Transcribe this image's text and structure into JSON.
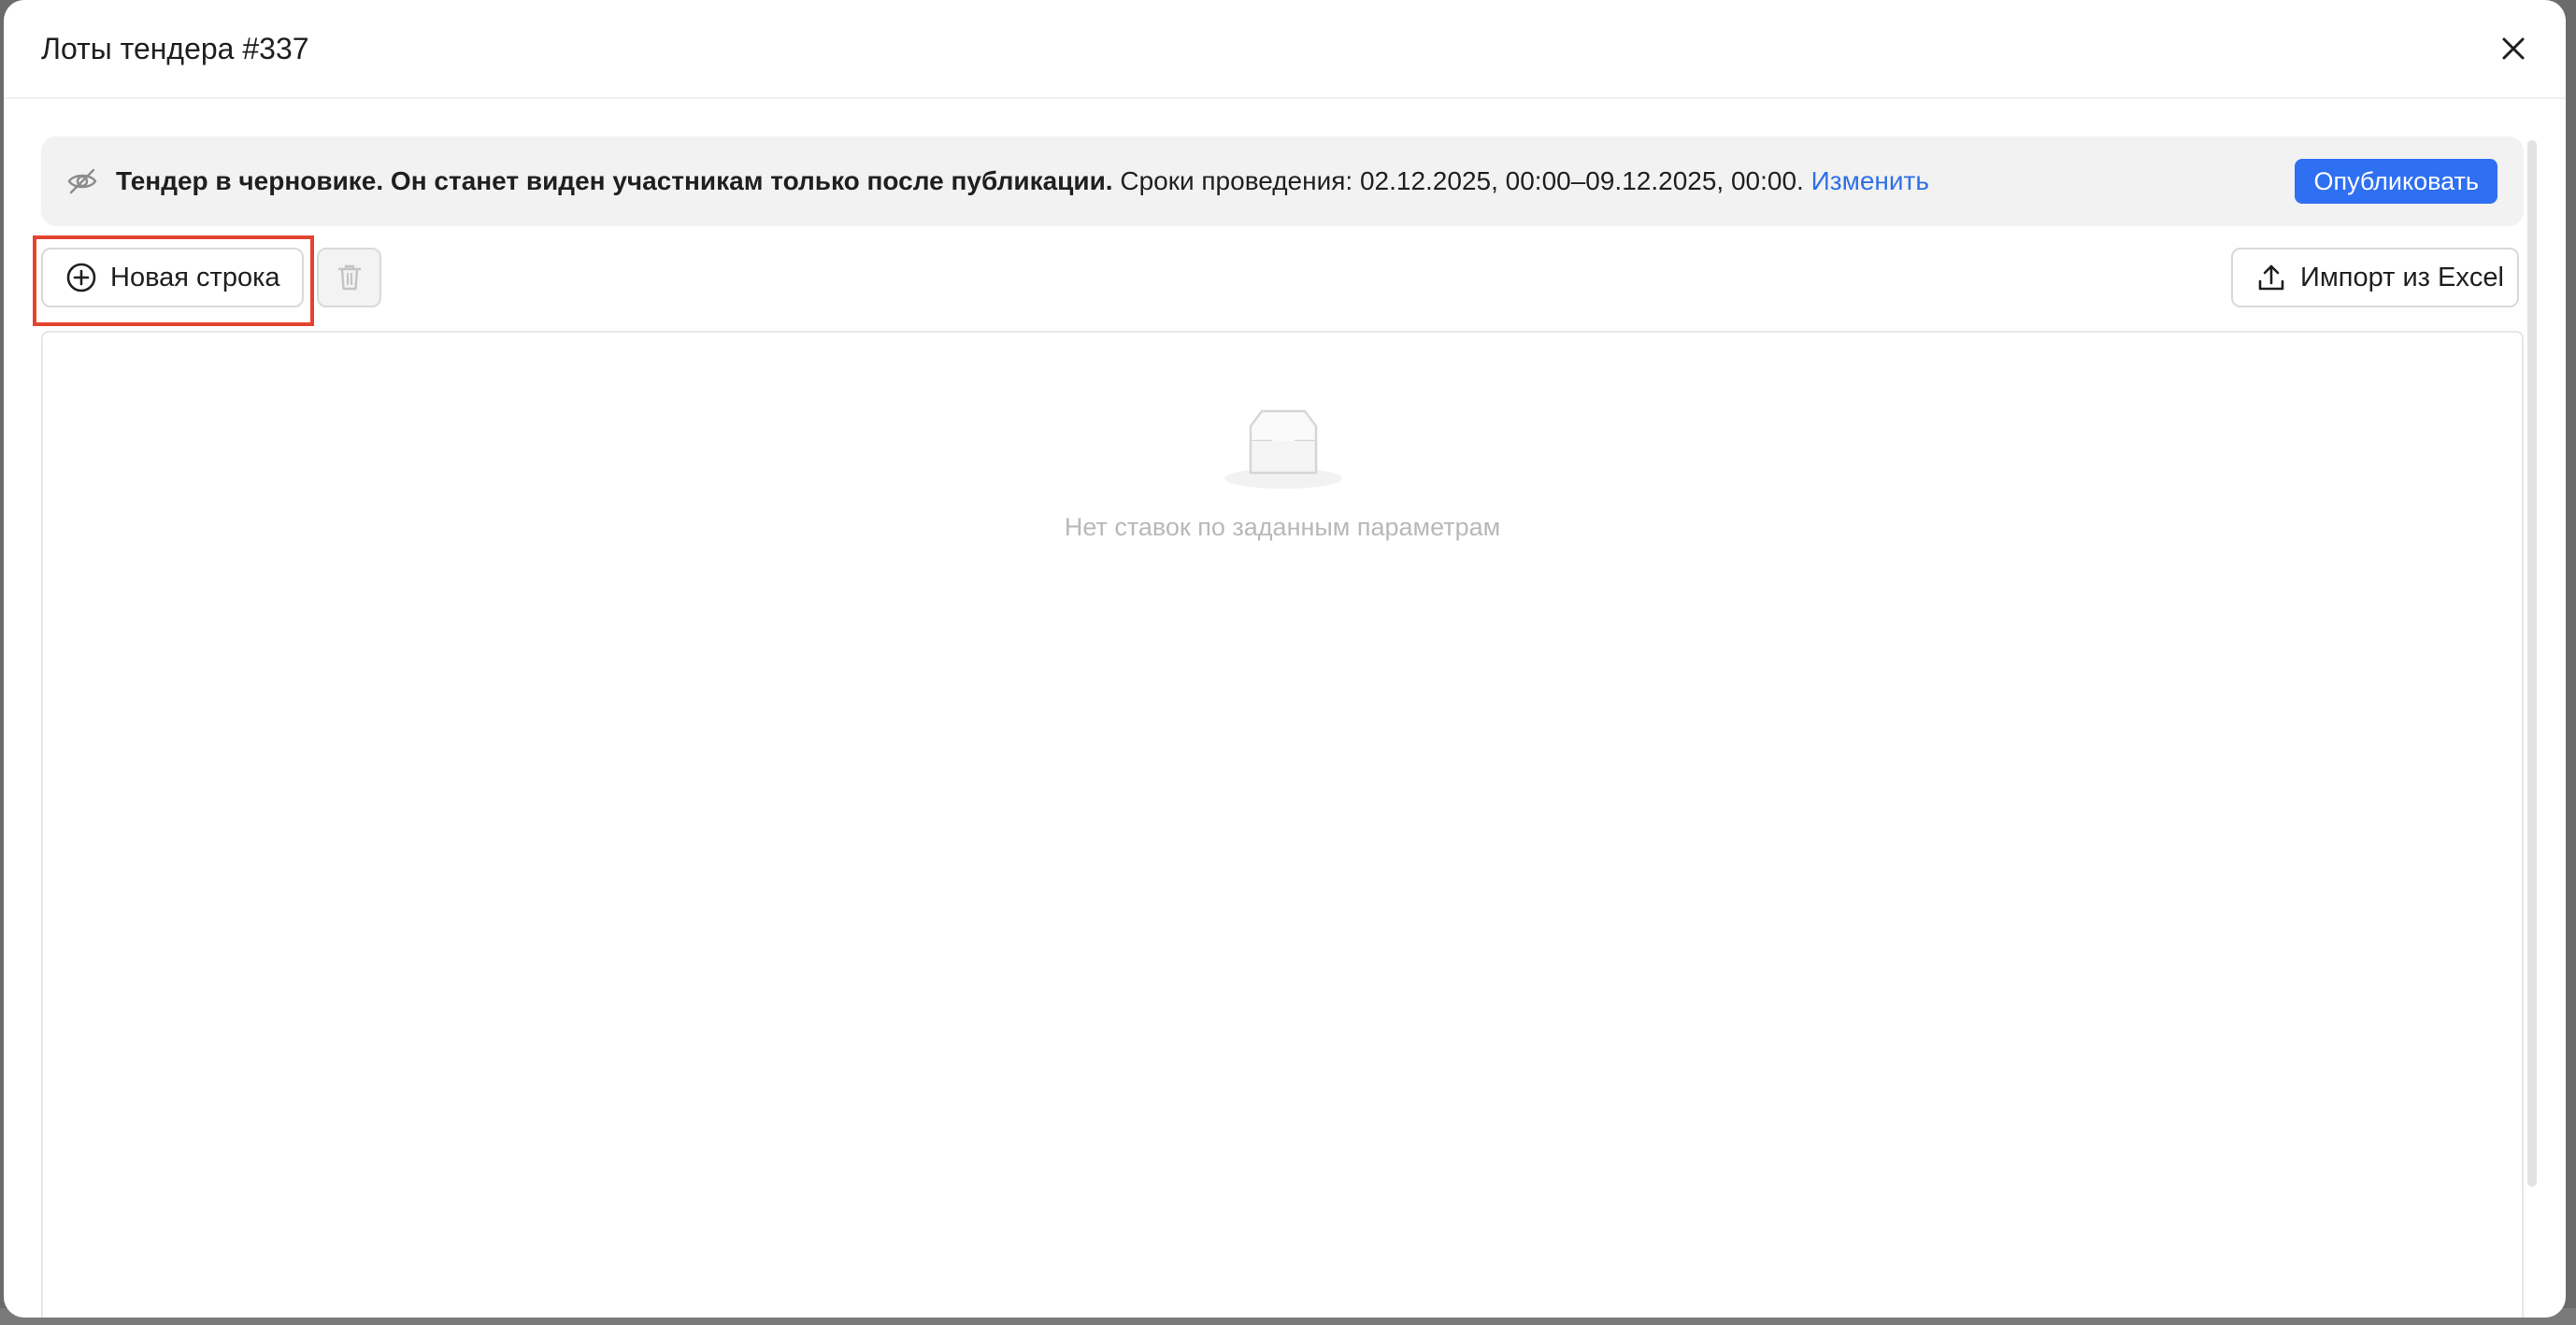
{
  "modal": {
    "title": "Лоты тендера #337",
    "close_icon": "close-icon"
  },
  "notice": {
    "icon": "eye-off-icon",
    "bold_text": "Тендер в черновике. Он станет виден участникам только после публикации.",
    "period_text": " Сроки проведения: 02.12.2025, 00:00–09.12.2025, 00:00. ",
    "change_link": "Изменить",
    "publish_label": "Опубликовать"
  },
  "toolbar": {
    "new_row_label": "Новая строка",
    "new_row_icon": "plus-circle-icon",
    "delete_icon": "trash-icon",
    "import_label": "Импорт из Excel",
    "import_icon": "upload-icon"
  },
  "table": {
    "empty_text": "Нет ставок по заданным параметрам",
    "empty_icon": "empty-inbox-icon"
  },
  "colors": {
    "accent": "#2f6ff2",
    "link": "#2f6fe6",
    "highlight": "#e5432f"
  }
}
